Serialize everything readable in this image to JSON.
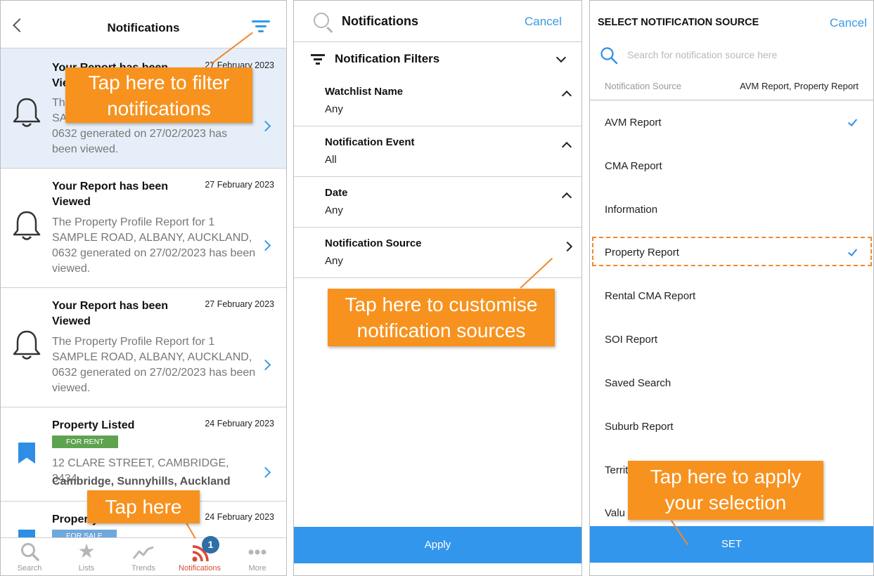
{
  "colors": {
    "accent": "#3396ed",
    "callout": "#f7921e",
    "active_tab": "#d94a35",
    "badge_rent": "#5ea34f",
    "badge_sale": "#6fa8dc"
  },
  "panel1": {
    "title": "Notifications",
    "notifications": [
      {
        "title": "Your Report has been Viewed",
        "date": "27 February 2023",
        "body": "The Property Profile Report for 1 SAMPLE ROAD, ALBANY, AUCKLAND, 0632 generated on 27/02/2023 has been viewed.",
        "title_visible": "Your Report has been Viewed",
        "body_visible": [
          "The",
          "SA",
          "0632 generated on 27/02/2023 has",
          "been viewed."
        ]
      },
      {
        "title": "Your Report has been Viewed",
        "date": "27 February 2023",
        "body": "The Property Profile Report for 1 SAMPLE ROAD, ALBANY, AUCKLAND, 0632 generated on 27/02/2023 has been viewed."
      },
      {
        "title": "Your Report has been Viewed",
        "date": "27 February 2023",
        "body": "The Property Profile Report for 1 SAMPLE ROAD, ALBANY, AUCKLAND, 0632 generated on 27/02/2023 has been viewed."
      },
      {
        "title": "Property Listed",
        "date": "24 February 2023",
        "badge": "FOR RENT",
        "address": "12 CLARE STREET, CAMBRIDGE, 3434",
        "locality": "Cambridge, Sunnyhills, Auckland"
      },
      {
        "title": "Property",
        "date": "24 February 2023",
        "badge": "FOR SALE"
      }
    ],
    "tabs": [
      {
        "label": "Search",
        "icon": "search-icon"
      },
      {
        "label": "Lists",
        "icon": "star-icon"
      },
      {
        "label": "Trends",
        "icon": "trends-icon"
      },
      {
        "label": "Notifications",
        "icon": "rss-icon",
        "badge": "1"
      },
      {
        "label": "More",
        "icon": "more-icon"
      }
    ]
  },
  "panel2": {
    "title": "Notifications",
    "cancel": "Cancel",
    "filters_title": "Notification Filters",
    "filters": [
      {
        "label": "Watchlist Name",
        "value": "Any"
      },
      {
        "label": "Notification Event",
        "value": "All"
      },
      {
        "label": "Date",
        "value": "Any"
      },
      {
        "label": "Notification Source",
        "value": "Any"
      }
    ],
    "apply": "Apply"
  },
  "panel3": {
    "title": "SELECT NOTIFICATION SOURCE",
    "cancel": "Cancel",
    "search_placeholder": "Search for notification source here",
    "source_label": "Notification Source",
    "source_value": "AVM Report, Property Report",
    "options": [
      {
        "label": "AVM Report",
        "checked": true
      },
      {
        "label": "CMA Report",
        "checked": false
      },
      {
        "label": "Information",
        "checked": false
      },
      {
        "label": "Property Report",
        "checked": true
      },
      {
        "label": "Rental CMA Report",
        "checked": false
      },
      {
        "label": "SOI Report",
        "checked": false
      },
      {
        "label": "Saved Search",
        "checked": false
      },
      {
        "label": "Suburb Report",
        "checked": false
      },
      {
        "label": "Territ",
        "checked": false
      },
      {
        "label": "Valu",
        "checked": false
      }
    ],
    "set": "SET"
  },
  "callouts": {
    "filter": [
      "Tap here to filter",
      "notifications"
    ],
    "tap": "Tap here",
    "customise": [
      "Tap here to customise",
      "notification sources"
    ],
    "apply": [
      "Tap here to apply",
      "your selection"
    ]
  }
}
